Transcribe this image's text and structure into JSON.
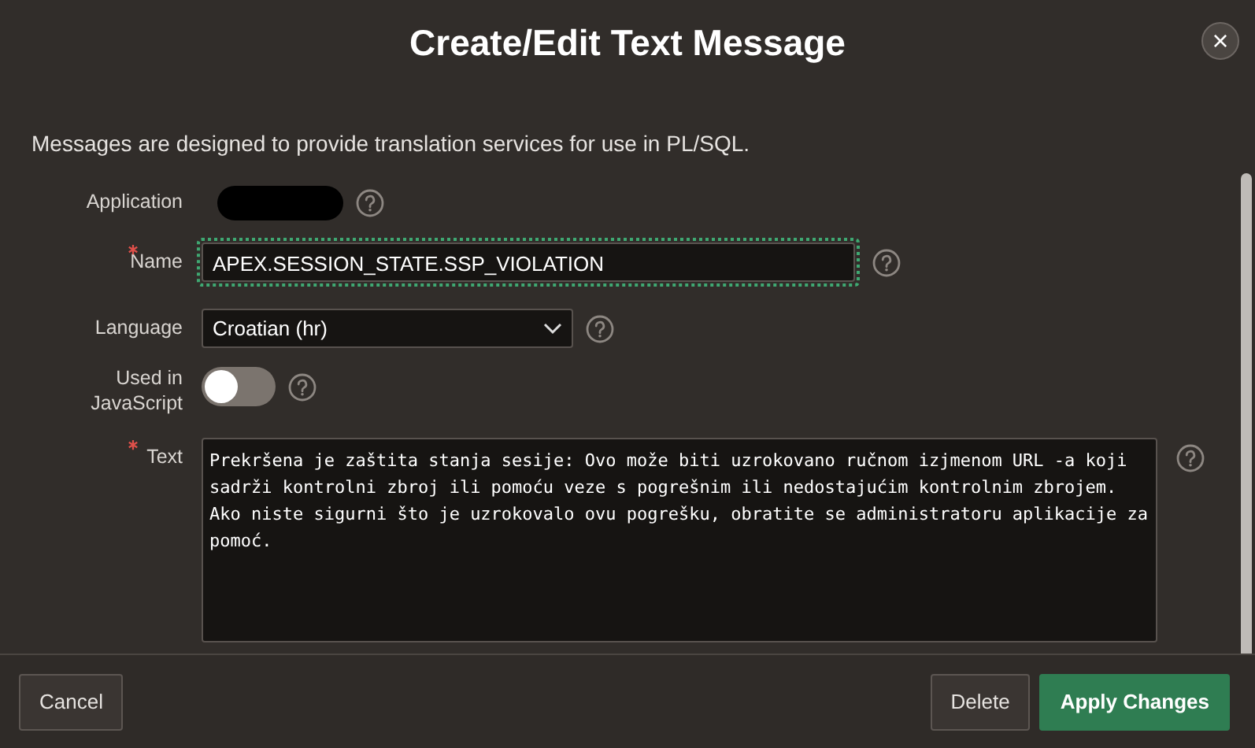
{
  "dialog": {
    "title": "Create/Edit Text Message",
    "close_label": "×"
  },
  "description": "Messages are designed to provide translation services for use in PL/SQL.",
  "fields": [
    {
      "kind": "redacted",
      "label": "Application",
      "required": false
    },
    {
      "kind": "text",
      "label": "Name",
      "required": true,
      "value": "APEX.SESSION_STATE.SSP_VIOLATION",
      "focused": true
    },
    {
      "kind": "select",
      "label": "Language",
      "required": false,
      "value": "Croatian (hr)"
    },
    {
      "kind": "switch",
      "label": "Used in JavaScript",
      "required": false,
      "on": false
    },
    {
      "kind": "textarea",
      "label": "Text",
      "required": true,
      "value": "Prekršena je zaštita stanja sesije: Ovo može biti uzrokovano ručnom izjmenom URL -a koji sadrži kontrolni zbroj ili pomoću veze s pogrešnim ili nedostajućim kontrolnim zbrojem. Ako niste sigurni što je uzrokovalo ovu pogrešku, obratite se administratoru aplikacije za pomoć."
    }
  ],
  "buttons": [
    {
      "label": "Cancel",
      "kind": "secondary"
    },
    {
      "label": "Delete",
      "kind": "secondary"
    },
    {
      "label": "Apply Changes",
      "kind": "primary"
    }
  ]
}
